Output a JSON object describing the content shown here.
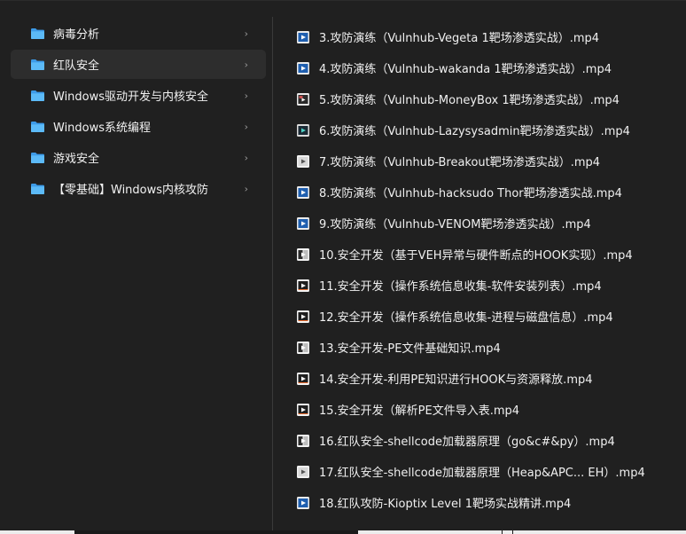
{
  "folders": [
    {
      "label": "病毒分析",
      "selected": false
    },
    {
      "label": "红队安全",
      "selected": true
    },
    {
      "label": "Windows驱动开发与内核安全",
      "selected": false
    },
    {
      "label": "Windows系统编程",
      "selected": false
    },
    {
      "label": "游戏安全",
      "selected": false
    },
    {
      "label": "【零基础】Windows内核攻防",
      "selected": false
    }
  ],
  "chevron": "›",
  "files": [
    {
      "label": "3.攻防演练（Vulnhub-Vegeta 1靶场渗透实战）.mp4",
      "icon": "video-blue-icon"
    },
    {
      "label": "4.攻防演练（Vulnhub-wakanda 1靶场渗透实战）.mp4",
      "icon": "video-blue-icon"
    },
    {
      "label": "5.攻防演练（Vulnhub-MoneyBox 1靶场渗透实战）.mp4",
      "icon": "video-thumb-icon"
    },
    {
      "label": "6.攻防演练（Vulnhub-Lazysysadmin靶场渗透实战）.mp4",
      "icon": "video-dark-icon"
    },
    {
      "label": "7.攻防演练（Vulnhub-Breakout靶场渗透实战）.mp4",
      "icon": "video-light-icon"
    },
    {
      "label": "8.攻防演练（Vulnhub-hacksudo Thor靶场渗透实战.mp4",
      "icon": "video-blue-icon"
    },
    {
      "label": "9.攻防演练（Vulnhub-VENOM靶场渗透实战）.mp4",
      "icon": "video-blue-icon"
    },
    {
      "label": "10.安全开发（基于VEH异常与硬件断点的HOOK实现）.mp4",
      "icon": "video-code-icon"
    },
    {
      "label": "11.安全开发（操作系统信息收集-软件安装列表）.mp4",
      "icon": "video-orange-icon"
    },
    {
      "label": "12.安全开发（操作系统信息收集-进程与磁盘信息）.mp4",
      "icon": "video-orange-icon"
    },
    {
      "label": "13.安全开发-PE文件基础知识.mp4",
      "icon": "video-code-icon"
    },
    {
      "label": "14.安全开发-利用PE知识进行HOOK与资源释放.mp4",
      "icon": "video-orange-icon"
    },
    {
      "label": "15.安全开发（解析PE文件导入表.mp4",
      "icon": "video-orange-icon"
    },
    {
      "label": "16.红队安全-shellcode加载器原理（go&c#&py）.mp4",
      "icon": "video-code-icon"
    },
    {
      "label": "17.红队安全-shellcode加载器原理（Heap&APC... EH）.mp4",
      "icon": "video-light-icon"
    },
    {
      "label": "18.红队攻防-Kioptix Level 1靶场实战精讲.mp4",
      "icon": "video-blue-icon"
    }
  ],
  "colors": {
    "background": "#202020",
    "selected": "#2d2d2d",
    "folder": "#4fb3f6",
    "text": "#f0f0f0"
  }
}
